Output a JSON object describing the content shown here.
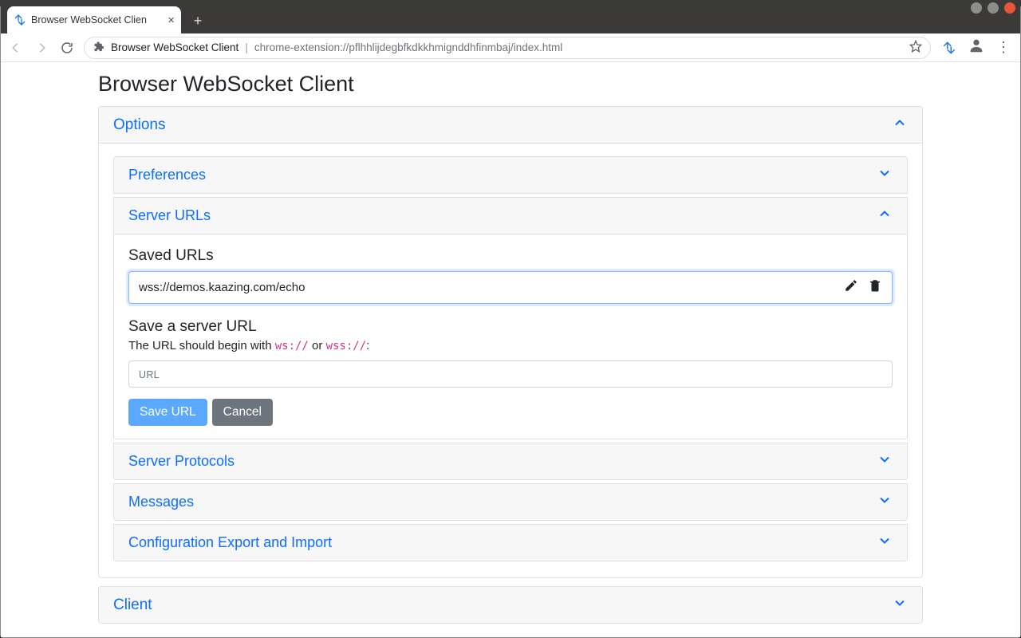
{
  "browser": {
    "tab_title": "Browser WebSocket Clien",
    "omnibox_host": "Browser WebSocket Client",
    "omnibox_path": "chrome-extension://pflhhlijdegbfkdkkhmignddhfinmbaj/index.html"
  },
  "page": {
    "title": "Browser WebSocket Client"
  },
  "panels": {
    "options": {
      "label": "Options",
      "expanded": true
    },
    "preferences": {
      "label": "Preferences",
      "expanded": false
    },
    "server_urls": {
      "label": "Server URLs",
      "expanded": true
    },
    "server_protocols": {
      "label": "Server Protocols",
      "expanded": false
    },
    "messages": {
      "label": "Messages",
      "expanded": false
    },
    "config": {
      "label": "Configuration Export and Import",
      "expanded": false
    },
    "client": {
      "label": "Client",
      "expanded": false
    }
  },
  "server_urls": {
    "saved_label": "Saved URLs",
    "saved": [
      {
        "url": "wss://demos.kaazing.com/echo"
      }
    ],
    "save_label": "Save a server URL",
    "hint_prefix": "The URL should begin with ",
    "hint_ws": "ws://",
    "hint_or": " or ",
    "hint_wss": "wss://",
    "hint_suffix": ":",
    "input_placeholder": "URL",
    "save_button": "Save URL",
    "cancel_button": "Cancel"
  }
}
